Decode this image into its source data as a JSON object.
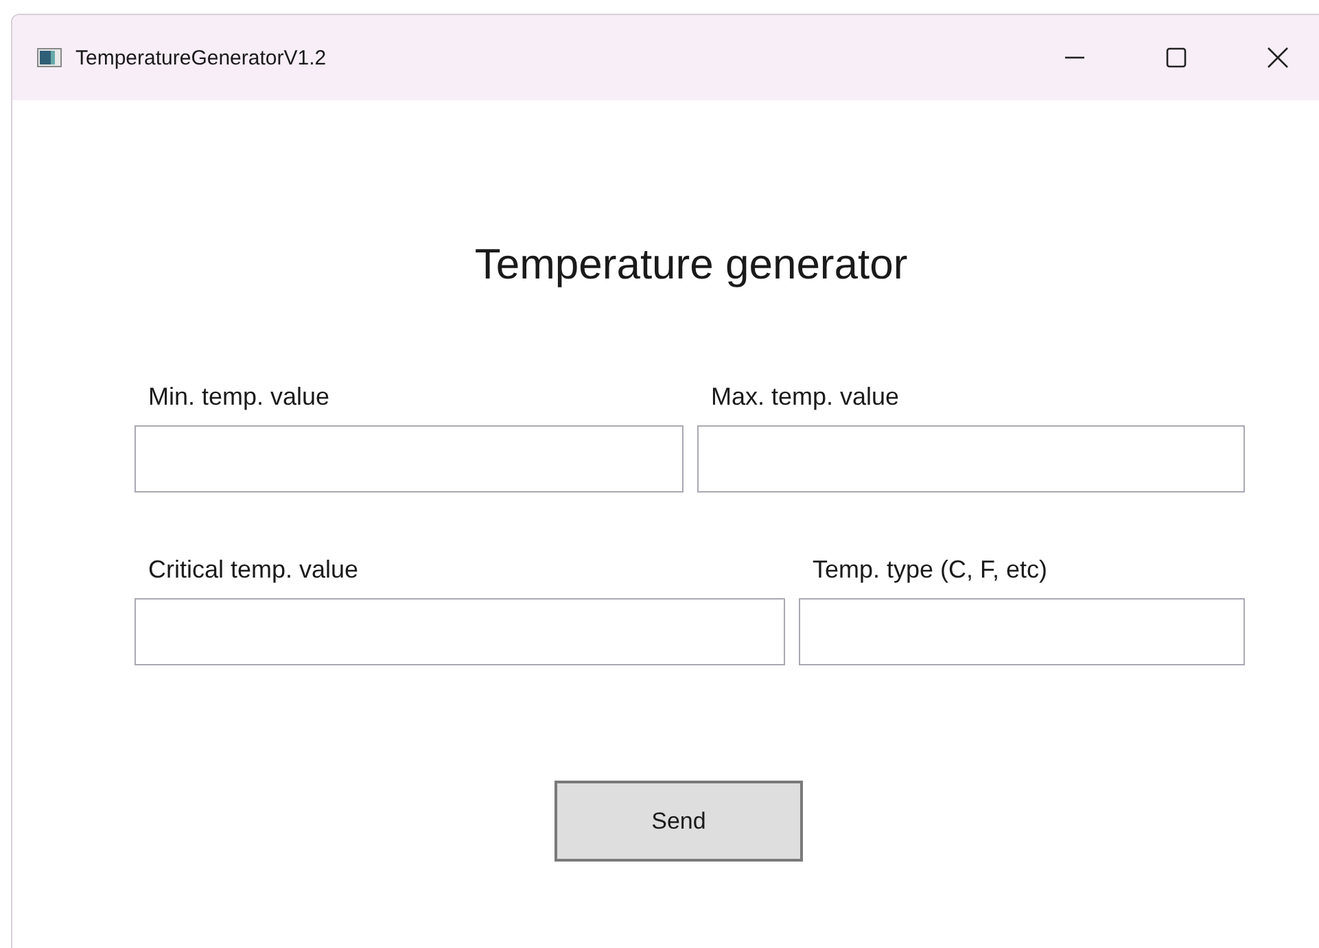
{
  "window": {
    "title": "TemperatureGeneratorV1.2"
  },
  "heading": "Temperature generator",
  "rows": [
    {
      "fields": [
        {
          "label": "Min. temp. value"
        },
        {
          "label": "Max. temp. value"
        }
      ]
    },
    {
      "fields": [
        {
          "label": "Critical temp. value"
        },
        {
          "label": "Temp. type (C, F, etc)"
        }
      ]
    }
  ],
  "button": "Send"
}
